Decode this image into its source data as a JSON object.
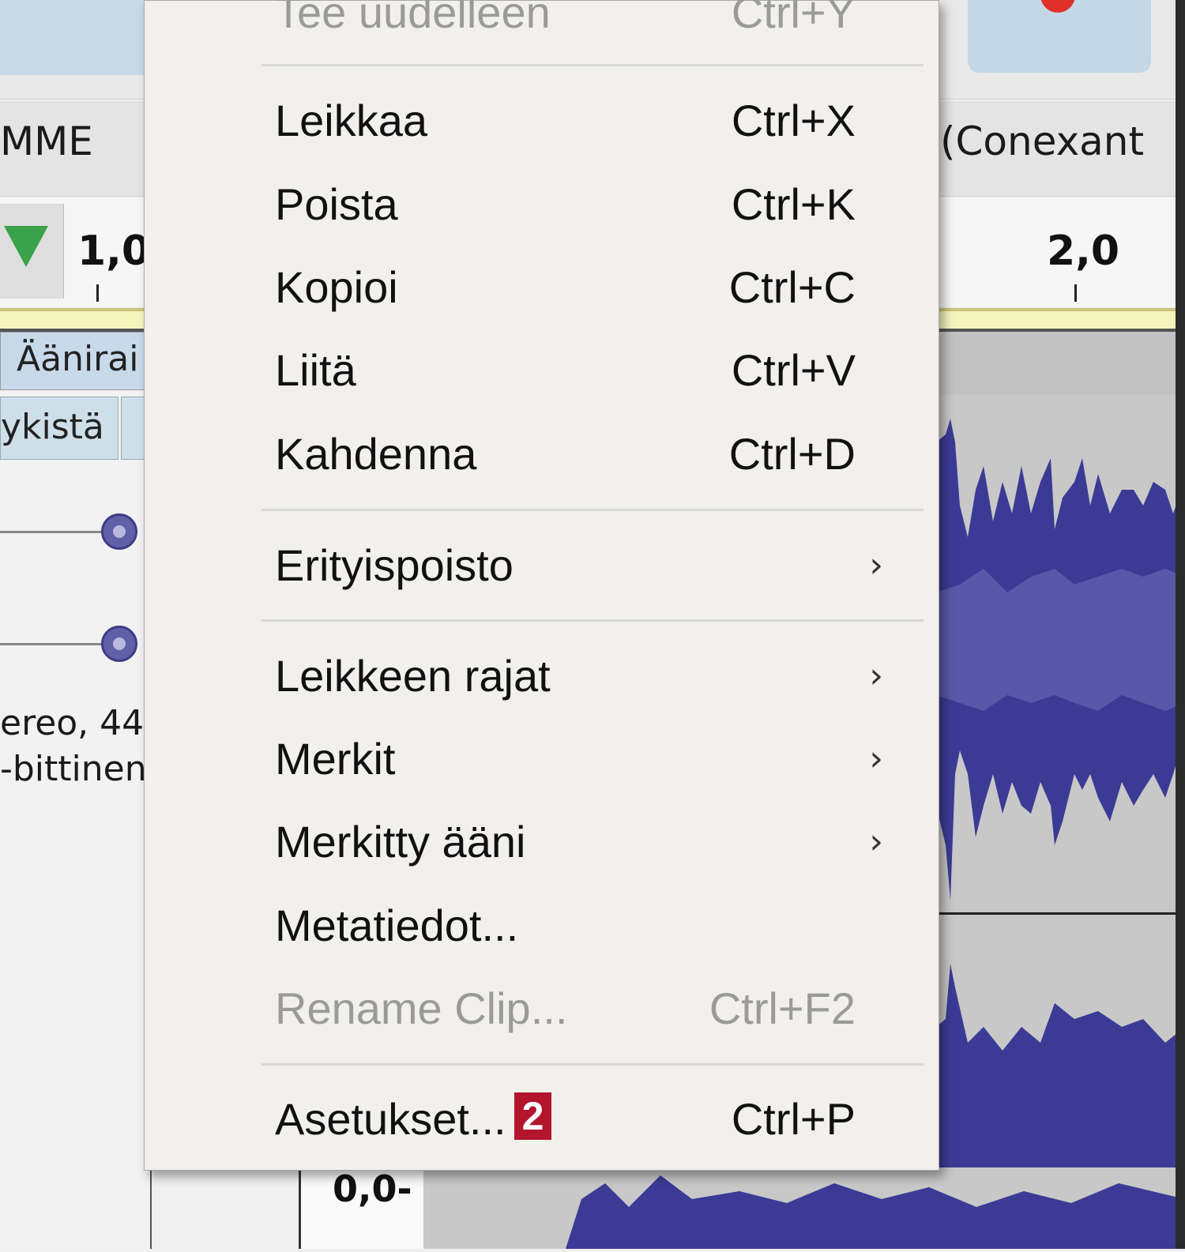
{
  "background": {
    "host_label": "MME",
    "device_label": "(Conexant",
    "ruler_ticks": [
      "1,0",
      "2,0"
    ],
    "track_name": "Äänirai",
    "track_button": "ykistä",
    "track_info_line1": "ereo, 44",
    "track_info_line2": "-bittinen",
    "bottom_scale": "0,0-",
    "colors": {
      "waveform": "#3b3b96",
      "record": "#e0302a",
      "play": "#3aa24a"
    }
  },
  "menu": {
    "top_partial": {
      "label": "Tee uudelleen",
      "shortcut": "Ctrl+Y"
    },
    "items": [
      {
        "label": "Leikkaa",
        "shortcut": "Ctrl+X"
      },
      {
        "label": "Poista",
        "shortcut": "Ctrl+K"
      },
      {
        "label": "Kopioi",
        "shortcut": "Ctrl+C"
      },
      {
        "label": "Liitä",
        "shortcut": "Ctrl+V"
      },
      {
        "label": "Kahdenna",
        "shortcut": "Ctrl+D"
      },
      {
        "label": "Erityispoisto",
        "submenu_icon": "chevron-right-icon"
      },
      {
        "label": "Leikkeen rajat",
        "submenu_icon": "chevron-right-icon"
      },
      {
        "label": "Merkit",
        "submenu_icon": "chevron-right-icon"
      },
      {
        "label": "Merkitty ääni",
        "submenu_icon": "chevron-right-icon"
      },
      {
        "label": "Metatiedot..."
      },
      {
        "label": "Rename Clip...",
        "shortcut": "Ctrl+F2",
        "disabled": true
      },
      {
        "label": "Asetukset...",
        "shortcut": "Ctrl+P",
        "badge": "2"
      }
    ],
    "arrow_glyph": "›",
    "badge_color": "#b3152d"
  }
}
